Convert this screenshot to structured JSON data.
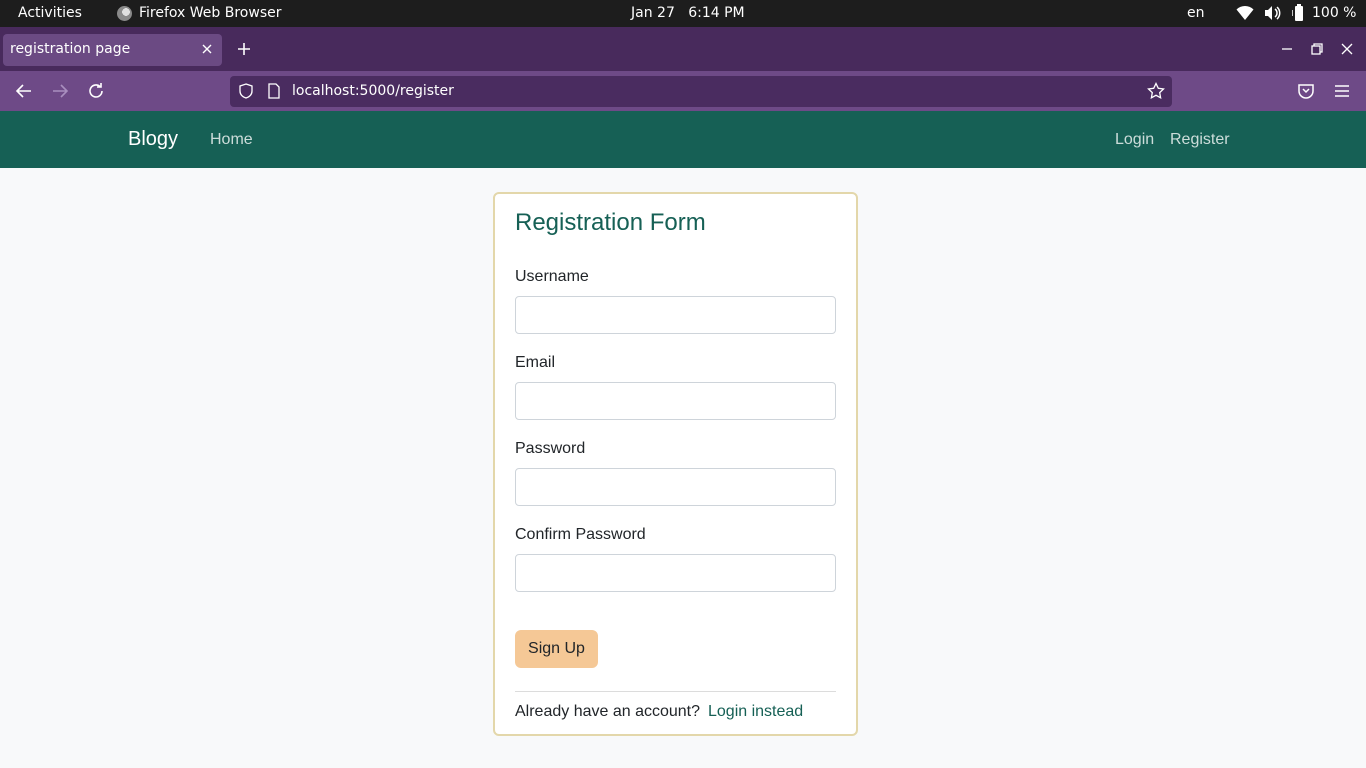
{
  "system_bar": {
    "activities": "Activities",
    "app_name": "Firefox Web Browser",
    "date": "Jan 27",
    "time": "6:14 PM",
    "language": "en",
    "battery": "100 %"
  },
  "browser": {
    "tab_title": "registration page",
    "url": "localhost:5000/register"
  },
  "site": {
    "brand": "Blogy",
    "nav_home": "Home",
    "nav_login": "Login",
    "nav_register": "Register"
  },
  "form": {
    "title": "Registration Form",
    "username_label": "Username",
    "username_value": "",
    "email_label": "Email",
    "email_value": "",
    "password_label": "Password",
    "password_value": "",
    "confirm_label": "Confirm Password",
    "confirm_value": "",
    "submit_label": "Sign Up",
    "footer_text": "Already have an account?",
    "footer_link": "Login instead"
  },
  "colors": {
    "brand_green": "#166055",
    "button_peach": "#f5c896",
    "card_border": "#e3d7aa",
    "browser_purple": "#6e4a87"
  }
}
